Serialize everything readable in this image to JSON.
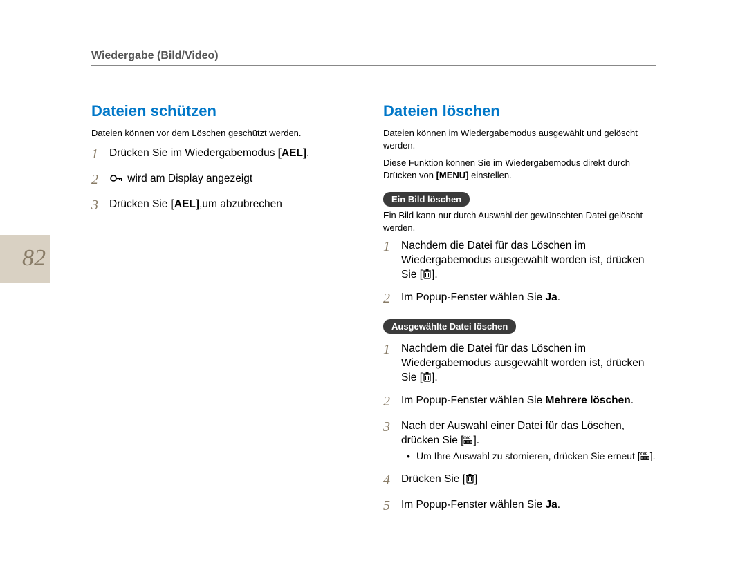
{
  "header": {
    "breadcrumb": "Wiedergabe (Bild/Video)"
  },
  "page_number": "82",
  "left": {
    "title": "Dateien schützen",
    "intro": "Dateien können vor dem Löschen geschützt werden.",
    "steps": [
      {
        "n": "1",
        "text_before": "Drücken Sie im Wiedergabemodus ",
        "bold": "[AEL]",
        "text_after": "."
      },
      {
        "n": "2",
        "icon": "key",
        "text_before": "",
        "text_after": " wird am Display angezeigt"
      },
      {
        "n": "3",
        "text_before": "Drücken Sie ",
        "bold": "[AEL]",
        "text_after": ",um abzubrechen"
      }
    ]
  },
  "right": {
    "title": "Dateien löschen",
    "intro": "Dateien können im Wiedergabemodus ausgewählt und gelöscht werden.",
    "note_before": "Diese Funktion können Sie im Wiedergabemodus direkt durch Drücken von ",
    "note_bold": "[MENU]",
    "note_after": " einstellen.",
    "section1": {
      "label": "Ein Bild löschen",
      "desc": "Ein Bild kann nur durch Auswahl der gewünschten Datei gelöscht werden.",
      "steps": [
        {
          "n": "1",
          "text_before": "Nachdem die Datei für das Löschen im Wiedergabemodus ausgewählt worden ist, drücken Sie [",
          "icon": "trash",
          "text_after": "]."
        },
        {
          "n": "2",
          "text_before": "Im Popup-Fenster wählen Sie ",
          "bold": "Ja",
          "text_after": "."
        }
      ]
    },
    "section2": {
      "label": "Ausgewählte Datei löschen",
      "steps": [
        {
          "n": "1",
          "text_before": "Nachdem die Datei für das Löschen im Wiedergabemodus ausgewählt worden ist, drücken Sie [",
          "icon": "trash",
          "text_after": "]."
        },
        {
          "n": "2",
          "text_before": "Im Popup-Fenster wählen Sie ",
          "bold": "Mehrere löschen",
          "text_after": "."
        },
        {
          "n": "3",
          "text_before": "Nach der Auswahl einer Datei für das Löschen, drücken Sie [",
          "icon": "ok",
          "text_after": "].",
          "bullets": [
            {
              "text_before": "Um Ihre Auswahl zu stornieren, drücken Sie erneut [",
              "icon": "ok",
              "text_after": "]."
            }
          ]
        },
        {
          "n": "4",
          "text_before": "Drücken Sie [",
          "icon": "trash",
          "text_after": "]"
        },
        {
          "n": "5",
          "text_before": "Im Popup-Fenster wählen Sie ",
          "bold": "Ja",
          "text_after": "."
        }
      ]
    }
  }
}
